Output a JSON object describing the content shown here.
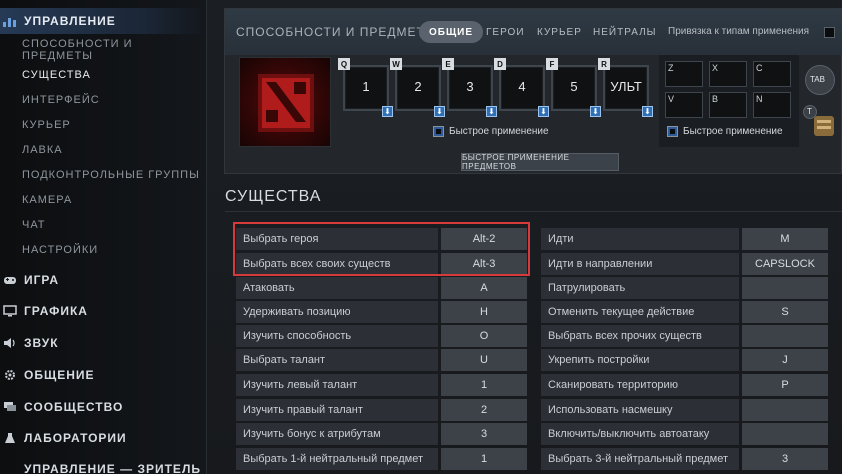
{
  "sidebar": {
    "sections": [
      {
        "label": "УПРАВЛЕНИЕ",
        "icon": "controls-icon"
      },
      {
        "label": "ИГРА",
        "icon": "gamepad-icon"
      },
      {
        "label": "ГРАФИКА",
        "icon": "monitor-icon"
      },
      {
        "label": "ЗВУК",
        "icon": "speaker-icon"
      },
      {
        "label": "ОБЩЕНИЕ",
        "icon": "gear-icon"
      },
      {
        "label": "СООБЩЕСТВО",
        "icon": "chat-icon"
      },
      {
        "label": "ЛАБОРАТОРИИ",
        "icon": "flask-icon"
      },
      {
        "label": "УПРАВЛЕНИЕ — ЗРИТЕЛЬ",
        "icon": ""
      }
    ],
    "items": [
      "СПОСОБНОСТИ И ПРЕДМЕТЫ",
      "СУЩЕСТВА",
      "ИНТЕРФЕЙС",
      "КУРЬЕР",
      "ЛАВКА",
      "ПОДКОНТРОЛЬНЫЕ ГРУППЫ",
      "КАМЕРА",
      "ЧАТ",
      "НАСТРОЙКИ"
    ]
  },
  "top": {
    "title": "СПОСОБНОСТИ И ПРЕДМЕТЫ",
    "tabs": [
      "ОБЩИЕ",
      "ГЕРОИ",
      "КУРЬЕР",
      "НЕЙТРАЛЫ"
    ],
    "cast_label": "Привязка к типам применения",
    "ability_slots": [
      {
        "key": "Q",
        "value": "1"
      },
      {
        "key": "W",
        "value": "2"
      },
      {
        "key": "E",
        "value": "3"
      },
      {
        "key": "D",
        "value": "4"
      },
      {
        "key": "F",
        "value": "5"
      },
      {
        "key": "R",
        "value": "УЛЬТ"
      }
    ],
    "item_slots": [
      "Z",
      "X",
      "C",
      "V",
      "B",
      "N"
    ],
    "tab_key": "TAB",
    "t_key": "T",
    "quickcast_label": "Быстрое применение",
    "quickcast_items_label": "Быстрое применение",
    "quickcast_items_button": "БЫСТРОЕ ПРИМЕНЕНИЕ ПРЕДМЕТОВ"
  },
  "units": {
    "title": "СУЩЕСТВА",
    "left": [
      {
        "label": "Выбрать героя",
        "key": "Alt-2"
      },
      {
        "label": "Выбрать всех своих существ",
        "key": "Alt-3"
      },
      {
        "label": "Атаковать",
        "key": "A"
      },
      {
        "label": "Удерживать позицию",
        "key": "H"
      },
      {
        "label": "Изучить способность",
        "key": "O"
      },
      {
        "label": "Выбрать талант",
        "key": "U"
      },
      {
        "label": "Изучить левый талант",
        "key": "1"
      },
      {
        "label": "Изучить правый талант",
        "key": "2"
      },
      {
        "label": "Изучить бонус к атрибутам",
        "key": "3"
      },
      {
        "label": "Выбрать 1-й нейтральный предмет",
        "key": "1"
      }
    ],
    "right": [
      {
        "label": "Идти",
        "key": "M"
      },
      {
        "label": "Идти в направлении",
        "key": "CAPSLOCK"
      },
      {
        "label": "Патрулировать",
        "key": ""
      },
      {
        "label": "Отменить текущее действие",
        "key": "S"
      },
      {
        "label": "Выбрать всех прочих существ",
        "key": ""
      },
      {
        "label": "Укрепить постройки",
        "key": "J"
      },
      {
        "label": "Сканировать территорию",
        "key": "P"
      },
      {
        "label": "Использовать насмешку",
        "key": ""
      },
      {
        "label": "Включить/выключить автоатаку",
        "key": ""
      },
      {
        "label": "Выбрать 3-й нейтральный предмет",
        "key": "3"
      }
    ]
  }
}
